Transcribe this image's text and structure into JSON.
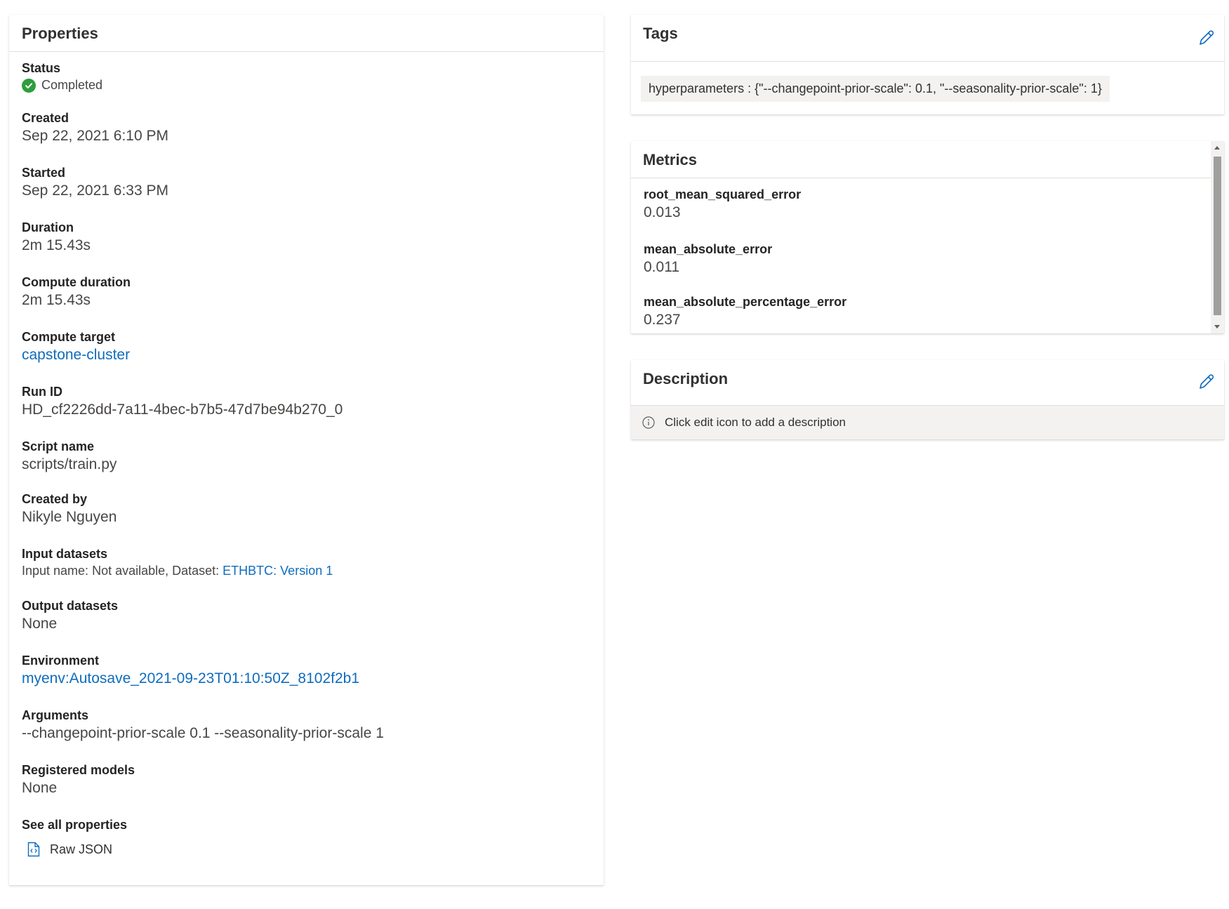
{
  "properties": {
    "title": "Properties",
    "status_label": "Status",
    "status_value": "Completed",
    "created_label": "Created",
    "created_value": "Sep 22, 2021 6:10 PM",
    "started_label": "Started",
    "started_value": "Sep 22, 2021 6:33 PM",
    "duration_label": "Duration",
    "duration_value": "2m 15.43s",
    "compute_duration_label": "Compute duration",
    "compute_duration_value": "2m 15.43s",
    "compute_target_label": "Compute target",
    "compute_target_value": "capstone-cluster",
    "run_id_label": "Run ID",
    "run_id_value": "HD_cf2226dd-7a11-4bec-b7b5-47d7be94b270_0",
    "script_name_label": "Script name",
    "script_name_value": "scripts/train.py",
    "created_by_label": "Created by",
    "created_by_value": "Nikyle Nguyen",
    "input_datasets_label": "Input datasets",
    "input_datasets_prefix": "Input name: Not available, Dataset: ",
    "input_datasets_link": "ETHBTC: Version 1",
    "output_datasets_label": "Output datasets",
    "output_datasets_value": "None",
    "environment_label": "Environment",
    "environment_value": "myenv:Autosave_2021-09-23T01:10:50Z_8102f2b1",
    "arguments_label": "Arguments",
    "arguments_value": "--changepoint-prior-scale 0.1 --seasonality-prior-scale 1",
    "registered_models_label": "Registered models",
    "registered_models_value": "None",
    "see_all_label": "See all properties",
    "raw_json_label": "Raw JSON"
  },
  "tags": {
    "title": "Tags",
    "items": [
      "hyperparameters : {\"--changepoint-prior-scale\": 0.1, \"--seasonality-prior-scale\": 1}"
    ]
  },
  "metrics": {
    "title": "Metrics",
    "items": [
      {
        "name": "root_mean_squared_error",
        "value": "0.013"
      },
      {
        "name": "mean_absolute_error",
        "value": "0.011"
      },
      {
        "name": "mean_absolute_percentage_error",
        "value": "0.237"
      }
    ]
  },
  "description": {
    "title": "Description",
    "placeholder": "Click edit icon to add a description"
  },
  "colors": {
    "link": "#0f6cbd",
    "status_success": "#2e9e3c",
    "chip_background": "#f3f2f1"
  },
  "icons": {
    "status": "check-circle-icon",
    "raw_json": "code-file-icon",
    "edit": "pencil-icon",
    "info": "info-icon"
  }
}
